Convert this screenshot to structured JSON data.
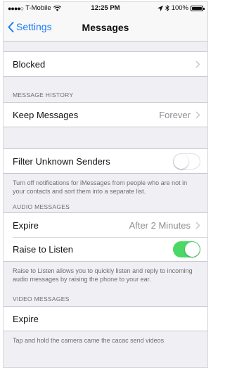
{
  "status_bar": {
    "carrier": "T-Mobile",
    "time": "12:25 PM",
    "battery": "100%"
  },
  "nav": {
    "back_label": "Settings",
    "title": "Messages"
  },
  "blocked": {
    "label": "Blocked"
  },
  "message_history": {
    "header": "MESSAGE HISTORY",
    "keep_messages": {
      "label": "Keep Messages",
      "value": "Forever"
    }
  },
  "filter": {
    "label": "Filter Unknown Senders",
    "enabled": false,
    "footer": "Turn off notifications for iMessages from people who are not in your contacts and sort them into a separate list."
  },
  "audio_messages": {
    "header": "AUDIO MESSAGES",
    "expire": {
      "label": "Expire",
      "value": "After 2 Minutes"
    },
    "raise_to_listen": {
      "label": "Raise to Listen",
      "enabled": true
    },
    "footer": "Raise to Listen allows you to quickly listen and reply to incoming audio messages by raising the phone to your ear."
  },
  "video_messages": {
    "header": "VIDEO MESSAGES",
    "expire": {
      "label": "Expire"
    },
    "footer": "Tap and hold the camera came the cacac send videos"
  },
  "colors": {
    "accent": "#1a7cf5",
    "toggle_on": "#4cd864",
    "background": "#efeff4"
  }
}
